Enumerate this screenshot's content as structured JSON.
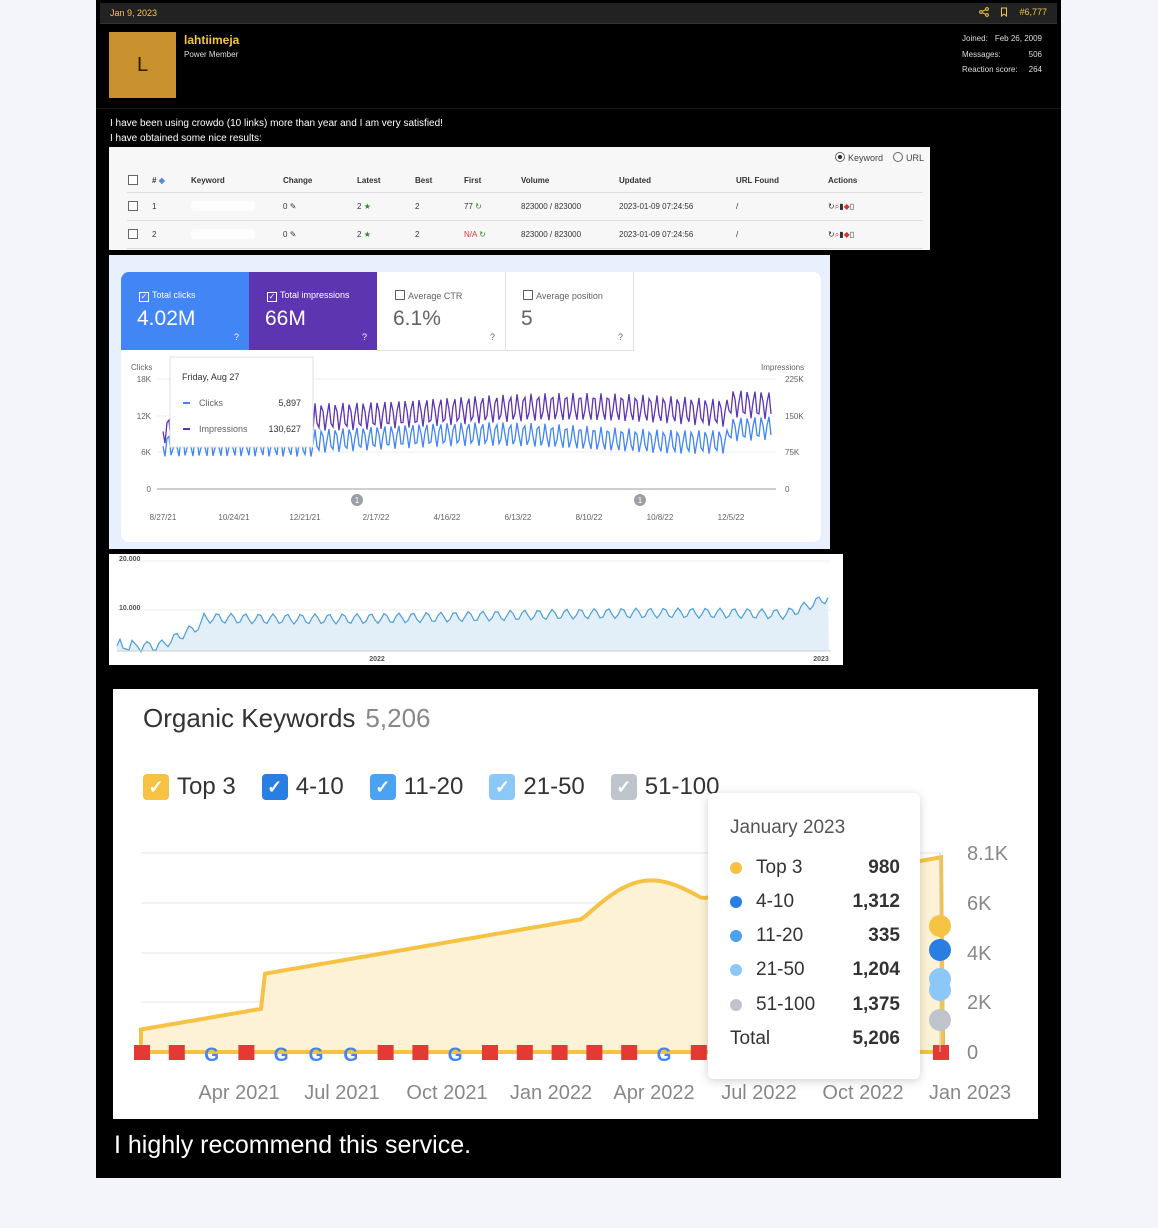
{
  "post": {
    "date": "Jan 9, 2023",
    "post_number": "#6,777",
    "user": {
      "avatar_letter": "L",
      "name": "lahtiimeja",
      "title": "Power Member"
    },
    "stats": [
      {
        "label": "Joined:",
        "value": "Feb 26, 2009"
      },
      {
        "label": "Messages:",
        "value": "506"
      },
      {
        "label": "Reaction score:",
        "value": "264"
      }
    ],
    "message_line1": "I have been using crowdo (10 links) more than year and I am very satisfied!",
    "message_line2": "I have obtained some nice results:",
    "closing": "I highly recommend this service."
  },
  "crowdo": {
    "radio_keyword": "Keyword",
    "radio_url": "URL",
    "headers": [
      "#",
      "Keyword",
      "Change",
      "Latest",
      "Best",
      "First",
      "Volume",
      "Updated",
      "URL Found",
      "Actions"
    ],
    "rows": [
      {
        "num": "1",
        "change": "0",
        "latest": "2",
        "best": "2",
        "first": "77",
        "volume": "823000 / 823000",
        "updated": "2023-01-09 07:24:56",
        "url": "/"
      },
      {
        "num": "2",
        "change": "0",
        "latest": "2",
        "best": "2",
        "first": "N/A",
        "volume": "823000 / 823000",
        "updated": "2023-01-09 07:24:56",
        "url": "/"
      }
    ]
  },
  "gsc": {
    "tiles": [
      {
        "label": "Total clicks",
        "value": "4.02M"
      },
      {
        "label": "Total impressions",
        "value": "66M"
      },
      {
        "label": "Average CTR",
        "value": "6.1%"
      },
      {
        "label": "Average position",
        "value": "5"
      }
    ],
    "tooltip": {
      "date": "Friday, Aug 27",
      "clicks_label": "Clicks",
      "clicks_value": "5,897",
      "impr_label": "Impressions",
      "impr_value": "130,627"
    },
    "left_axis_title": "Clicks",
    "right_axis_title": "Impressions",
    "left_ticks": [
      "18K",
      "12K",
      "6K",
      "0"
    ],
    "right_ticks": [
      "225K",
      "150K",
      "75K",
      "0"
    ],
    "x_ticks": [
      "8/27/21",
      "10/24/21",
      "12/21/21",
      "2/17/22",
      "4/16/22",
      "6/13/22",
      "8/10/22",
      "10/8/22",
      "12/5/22"
    ],
    "marker": "1",
    "colors": {
      "clicks": "#4285f4",
      "impressions": "#5e35b1"
    }
  },
  "traffic": {
    "y_ticks": [
      "20.000",
      "10.000"
    ],
    "x_ticks": [
      "2022",
      "2023"
    ],
    "color": "#4a9ed8"
  },
  "semrush": {
    "title": "Organic Keywords",
    "total": "5,206",
    "legend": [
      {
        "label": "Top 3",
        "color": "#f5c244"
      },
      {
        "label": "4-10",
        "color": "#2a7de1"
      },
      {
        "label": "11-20",
        "color": "#4aa3f0"
      },
      {
        "label": "21-50",
        "color": "#8cc8f7"
      },
      {
        "label": "51-100",
        "color": "#bfc4cc"
      }
    ],
    "y_ticks": [
      "8.1K",
      "6K",
      "4K",
      "2K",
      "0"
    ],
    "x_ticks": [
      "Apr 2021",
      "Jul 2021",
      "Oct 2021",
      "Jan 2022",
      "Apr 2022",
      "Jul 2022",
      "Oct 2022",
      "Jan 2023"
    ],
    "tooltip": {
      "title": "January 2023",
      "rows": [
        {
          "label": "Top 3",
          "value": "980",
          "color": "#f5c244"
        },
        {
          "label": "4-10",
          "value": "1,312",
          "color": "#2a7de1"
        },
        {
          "label": "11-20",
          "value": "335",
          "color": "#4aa3f0"
        },
        {
          "label": "21-50",
          "value": "1,204",
          "color": "#8cc8f7"
        },
        {
          "label": "51-100",
          "value": "1,375",
          "color": "#bfc4cc"
        }
      ],
      "total_label": "Total",
      "total_value": "5,206"
    },
    "event_flags": [
      "R",
      "R",
      "G",
      "R",
      "G",
      "G",
      "G",
      "R",
      "R",
      "G",
      "R",
      "R",
      "R",
      "R",
      "R",
      "G",
      "R"
    ]
  }
}
